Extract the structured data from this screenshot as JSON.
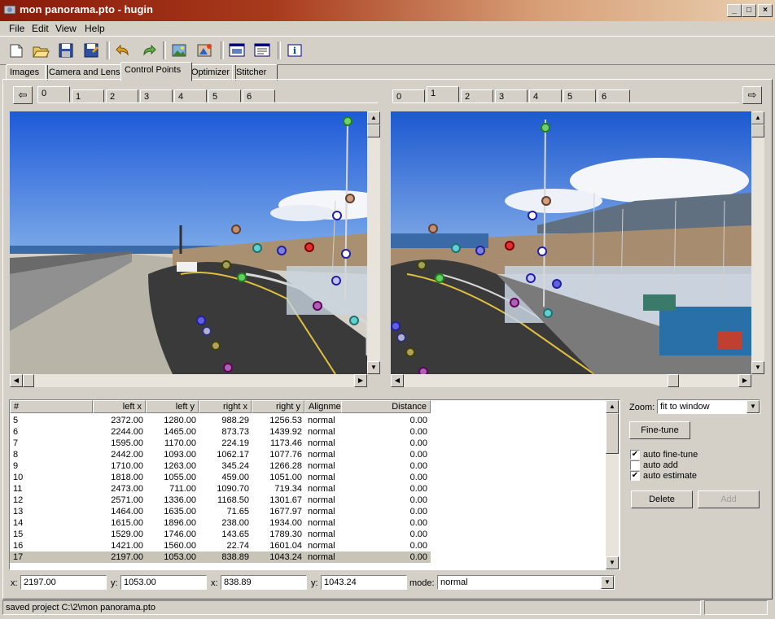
{
  "window": {
    "title": "mon panorama.pto - hugin",
    "buttons": [
      "_",
      "□",
      "×"
    ]
  },
  "menu": [
    "File",
    "Edit",
    "View",
    "Help"
  ],
  "toolbar_icons": [
    "new-icon",
    "open-icon",
    "save-icon",
    "save-as-icon",
    "undo-icon",
    "redo-icon",
    "add-images-icon",
    "optimize-icon",
    "preview-icon",
    "properties-icon",
    "about-icon"
  ],
  "main_tabs": [
    "Images",
    "Camera and Lens",
    "Control Points",
    "Optimizer",
    "Stitcher"
  ],
  "left_image_tabs": [
    "0",
    "1",
    "2",
    "3",
    "4",
    "5",
    "6"
  ],
  "right_image_tabs": [
    "0",
    "1",
    "2",
    "3",
    "4",
    "5",
    "6"
  ],
  "table": {
    "headers": [
      "#",
      "left x",
      "left y",
      "right x",
      "right y",
      "Alignment",
      "Distance"
    ],
    "rows": [
      [
        "5",
        "2372.00",
        "1280.00",
        "988.29",
        "1256.53",
        "normal",
        "0.00"
      ],
      [
        "6",
        "2244.00",
        "1465.00",
        "873.73",
        "1439.92",
        "normal",
        "0.00"
      ],
      [
        "7",
        "1595.00",
        "1170.00",
        "224.19",
        "1173.46",
        "normal",
        "0.00"
      ],
      [
        "8",
        "2442.00",
        "1093.00",
        "1062.17",
        "1077.76",
        "normal",
        "0.00"
      ],
      [
        "9",
        "1710.00",
        "1263.00",
        "345.24",
        "1266.28",
        "normal",
        "0.00"
      ],
      [
        "10",
        "1818.00",
        "1055.00",
        "459.00",
        "1051.00",
        "normal",
        "0.00"
      ],
      [
        "11",
        "2473.00",
        "711.00",
        "1090.70",
        "719.34",
        "normal",
        "0.00"
      ],
      [
        "12",
        "2571.00",
        "1336.00",
        "1168.50",
        "1301.67",
        "normal",
        "0.00"
      ],
      [
        "13",
        "1464.00",
        "1635.00",
        "71.65",
        "1677.97",
        "normal",
        "0.00"
      ],
      [
        "14",
        "1615.00",
        "1896.00",
        "238.00",
        "1934.00",
        "normal",
        "0.00"
      ],
      [
        "15",
        "1529.00",
        "1746.00",
        "143.65",
        "1789.30",
        "normal",
        "0.00"
      ],
      [
        "16",
        "1421.00",
        "1560.00",
        "22.74",
        "1601.04",
        "normal",
        "0.00"
      ],
      [
        "17",
        "2197.00",
        "1053.00",
        "838.89",
        "1043.24",
        "normal",
        "0.00"
      ]
    ]
  },
  "controls": {
    "zoom_label": "Zoom:",
    "zoom_value": "fit to window",
    "finetune_button": "Fine-tune",
    "auto_finetune": {
      "label": "auto fine-tune",
      "checked": true
    },
    "auto_add": {
      "label": "auto add",
      "checked": false
    },
    "auto_estimate": {
      "label": "auto estimate",
      "checked": true
    },
    "delete_button": "Delete",
    "add_button": "Add"
  },
  "fields": {
    "x_label": "x:",
    "x1": "2197.00",
    "y_label": "y:",
    "y1": "1053.00",
    "x2_label": "x:",
    "x2": "838.89",
    "y2_label": "y:",
    "y2": "1043.24",
    "mode_label": "mode:",
    "mode": "normal"
  },
  "status": "saved project C:\\2\\mon panorama.pto",
  "colors": {
    "title_start": "#8a1a0a",
    "face": "#d4d0c8",
    "selection": "#c8c4b8"
  }
}
